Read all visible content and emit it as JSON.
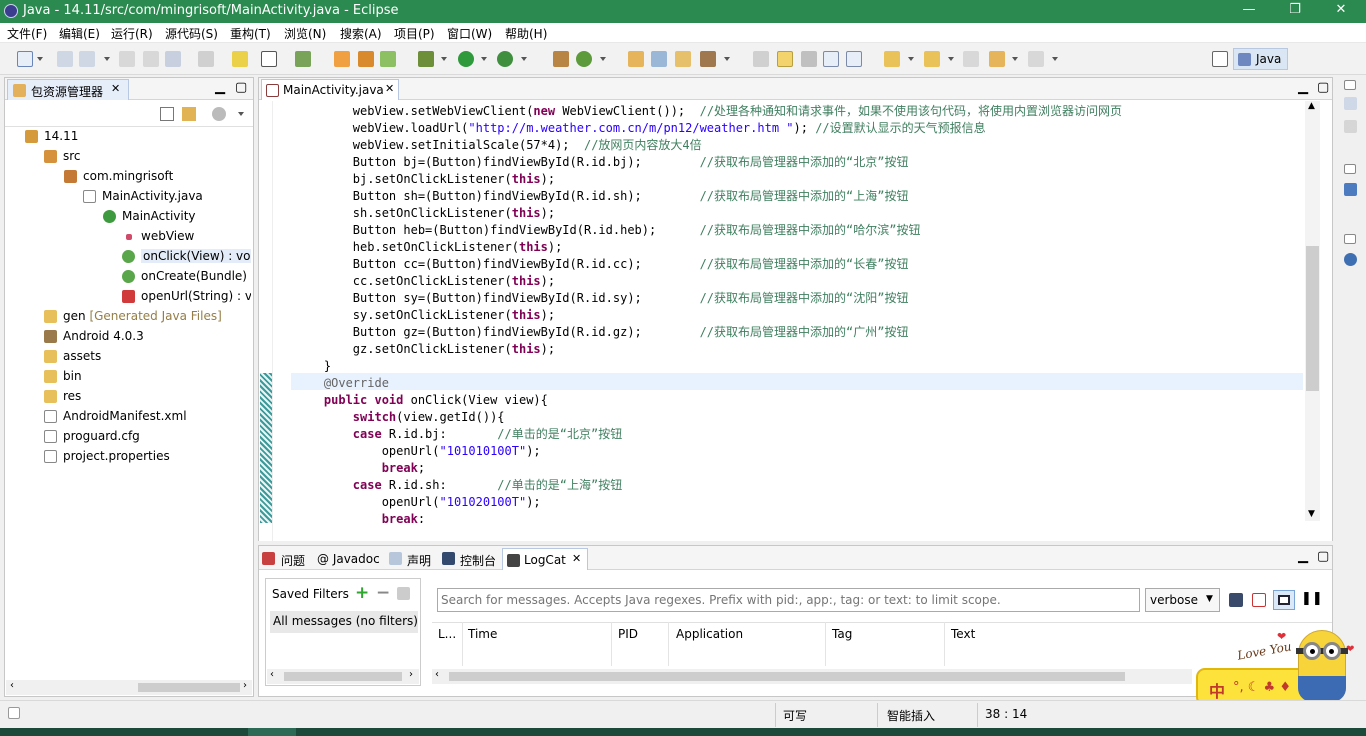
{
  "window": {
    "title": "Java  -  14.11/src/com/mingrisoft/MainActivity.java  -  Eclipse"
  },
  "menu": [
    "文件(F)",
    "编辑(E)",
    "运行(R)",
    "源代码(S)",
    "重构(T)",
    "浏览(N)",
    "搜索(A)",
    "项目(P)",
    "窗口(W)",
    "帮助(H)"
  ],
  "perspective": {
    "label": "Java"
  },
  "package_explorer": {
    "tab_label": "包资源管理器",
    "tree": [
      {
        "label": "14.11",
        "icon": "project-icon"
      },
      {
        "label": "src",
        "icon": "source-folder-icon"
      },
      {
        "label": "com.mingrisoft",
        "icon": "package-icon"
      },
      {
        "label": "MainActivity.java",
        "icon": "java-file-icon"
      },
      {
        "label": "MainActivity",
        "icon": "class-icon"
      },
      {
        "label": "webView",
        "icon": "field-icon"
      },
      {
        "label": "onClick(View) : voi",
        "icon": "method-icon"
      },
      {
        "label": "onCreate(Bundle)",
        "icon": "method-icon"
      },
      {
        "label": "openUrl(String) : v",
        "icon": "private-method-icon"
      },
      {
        "label": "gen",
        "suffix": "[Generated Java Files]",
        "icon": "folder-icon"
      },
      {
        "label": "Android 4.0.3",
        "icon": "library-icon"
      },
      {
        "label": "assets",
        "icon": "folder-icon"
      },
      {
        "label": "bin",
        "icon": "folder-icon"
      },
      {
        "label": "res",
        "icon": "folder-icon"
      },
      {
        "label": "AndroidManifest.xml",
        "icon": "xml-file-icon"
      },
      {
        "label": "proguard.cfg",
        "icon": "file-icon"
      },
      {
        "label": "project.properties",
        "icon": "file-icon"
      }
    ]
  },
  "editor": {
    "tab_label": "MainActivity.java",
    "lines": [
      [
        [
          "",
          "        webView.setWebViewClient("
        ],
        [
          "kw",
          "new"
        ],
        [
          "",
          " WebViewClient());  "
        ],
        [
          "cm",
          "//处理各种通知和请求事件，如果不使用该句代码，将使用内置浏览器访问网页"
        ]
      ],
      [
        [
          "",
          "        webView.loadUrl("
        ],
        [
          "st",
          "\"http://m.weather.com.cn/m/pn12/weather.htm \""
        ],
        [
          "",
          "); "
        ],
        [
          "cm",
          "//设置默认显示的天气预报信息"
        ]
      ],
      [
        [
          "",
          "        webView.setInitialScale(57*4);  "
        ],
        [
          "cm",
          "//放网页内容放大4倍"
        ]
      ],
      [
        [
          "",
          "        Button bj=(Button)findViewById(R.id.bj);        "
        ],
        [
          "cm",
          "//获取布局管理器中添加的“北京”按钮"
        ]
      ],
      [
        [
          "",
          "        bj.setOnClickListener("
        ],
        [
          "kw",
          "this"
        ],
        [
          "",
          ");"
        ]
      ],
      [
        [
          "",
          "        Button sh=(Button)findViewById(R.id.sh);        "
        ],
        [
          "cm",
          "//获取布局管理器中添加的“上海”按钮"
        ]
      ],
      [
        [
          "",
          "        sh.setOnClickListener("
        ],
        [
          "kw",
          "this"
        ],
        [
          "",
          ");"
        ]
      ],
      [
        [
          "",
          "        Button heb=(Button)findViewById(R.id.heb);      "
        ],
        [
          "cm",
          "//获取布局管理器中添加的“哈尔滨”按钮"
        ]
      ],
      [
        [
          "",
          "        heb.setOnClickListener("
        ],
        [
          "kw",
          "this"
        ],
        [
          "",
          ");"
        ]
      ],
      [
        [
          "",
          "        Button cc=(Button)findViewById(R.id.cc);        "
        ],
        [
          "cm",
          "//获取布局管理器中添加的“长春”按钮"
        ]
      ],
      [
        [
          "",
          "        cc.setOnClickListener("
        ],
        [
          "kw",
          "this"
        ],
        [
          "",
          ");"
        ]
      ],
      [
        [
          "",
          "        Button sy=(Button)findViewById(R.id.sy);        "
        ],
        [
          "cm",
          "//获取布局管理器中添加的“沈阳”按钮"
        ]
      ],
      [
        [
          "",
          "        sy.setOnClickListener("
        ],
        [
          "kw",
          "this"
        ],
        [
          "",
          ");"
        ]
      ],
      [
        [
          "",
          "        Button gz=(Button)findViewById(R.id.gz);        "
        ],
        [
          "cm",
          "//获取布局管理器中添加的“广州”按钮"
        ]
      ],
      [
        [
          "",
          "        gz.setOnClickListener("
        ],
        [
          "kw",
          "this"
        ],
        [
          "",
          ");"
        ]
      ],
      [
        [
          "",
          "    }"
        ]
      ],
      [
        [
          "an",
          "    @Override"
        ]
      ],
      [
        [
          "kw",
          "    public"
        ],
        [
          "",
          ""
        ],
        [
          "kw",
          " void"
        ],
        [
          "",
          " onClick(View view){"
        ]
      ],
      [
        [
          "kw",
          "        switch"
        ],
        [
          "",
          "(view.getId()){"
        ]
      ],
      [
        [
          "kw",
          "        case"
        ],
        [
          "",
          " R.id.bj:       "
        ],
        [
          "cm",
          "//单击的是“北京”按钮"
        ]
      ],
      [
        [
          "",
          "            openUrl("
        ],
        [
          "st",
          "\"101010100T\""
        ],
        [
          "",
          ");"
        ]
      ],
      [
        [
          "kw",
          "            break"
        ],
        [
          "",
          ";"
        ]
      ],
      [
        [
          "kw",
          "        case"
        ],
        [
          "",
          " R.id.sh:       "
        ],
        [
          "cm",
          "//单击的是“上海”按钮"
        ]
      ],
      [
        [
          "",
          "            openUrl("
        ],
        [
          "st",
          "\"101020100T\""
        ],
        [
          "",
          ");"
        ]
      ],
      [
        [
          "kw",
          "            break"
        ],
        [
          "",
          ";"
        ]
      ]
    ]
  },
  "bottom_tabs": [
    "问题",
    "@ Javadoc",
    "声明",
    "控制台",
    "LogCat"
  ],
  "logcat": {
    "saved_filters_label": "Saved Filters",
    "filter_item": "All messages (no filters)",
    "search_placeholder": "Search for messages. Accepts Java regexes. Prefix with pid:, app:, tag: or text: to limit scope.",
    "level": "verbose",
    "columns": [
      "L...",
      "Time",
      "PID",
      "Application",
      "Tag",
      "Text"
    ]
  },
  "status": {
    "writable": "可写",
    "insert_mode": "智能插入",
    "position": "38 : 14"
  },
  "ime": {
    "love_text": "Love You",
    "ime_label": "中",
    "ime_symbols": "°, ☾ ♣ ♦"
  }
}
